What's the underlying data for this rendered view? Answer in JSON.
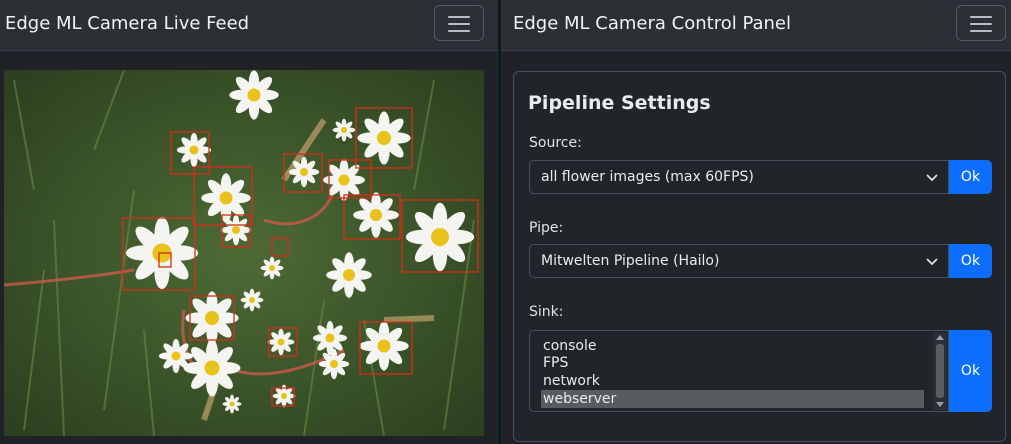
{
  "left_panel": {
    "title": "Edge ML Camera Live Feed",
    "menu_icon": "hamburger-menu-icon"
  },
  "right_panel": {
    "title": "Edge ML Camera Control Panel",
    "menu_icon": "hamburger-menu-icon",
    "card": {
      "title": "Pipeline Settings",
      "source": {
        "label": "Source:",
        "selected": "all flower images (max 60FPS)",
        "button": "Ok"
      },
      "pipe": {
        "label": "Pipe:",
        "selected": "Mitwelten Pipeline (Hailo)",
        "button": "Ok"
      },
      "sink": {
        "label": "Sink:",
        "options": [
          "console",
          "FPS",
          "network",
          "webserver"
        ],
        "selected": "webserver",
        "button": "Ok"
      }
    }
  },
  "colors": {
    "accent": "#0d6efd",
    "detection_box": "#d62c1a",
    "background": "#1f2226"
  }
}
